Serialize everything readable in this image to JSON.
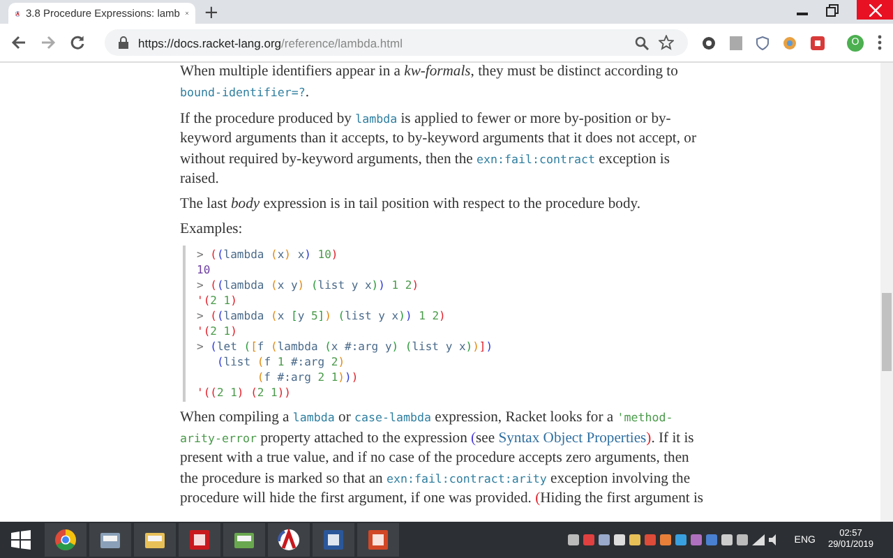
{
  "browser": {
    "tab": {
      "title": "3.8 Procedure Expressions: lamb",
      "selected": true
    },
    "new_tab": "+",
    "url": {
      "host": "https://docs.racket-lang.org",
      "path": "/reference/lambda.html"
    },
    "profile": "O"
  },
  "paragraphs": [
    [
      {
        "text": "When multiple identifiers appear in a ",
        "kind": "text"
      },
      {
        "text": "kw-formals",
        "kind": "ital"
      },
      {
        "text": ", they must be distinct according to ",
        "kind": "text"
      },
      {
        "text": "bound-identifier=?",
        "kind": "code"
      },
      {
        "text": ".",
        "kind": "text"
      }
    ],
    [
      {
        "text": "If the procedure produced by ",
        "kind": "text"
      },
      {
        "text": "lambda",
        "kind": "code"
      },
      {
        "text": " is applied to fewer or more by-position or by-keyword arguments than it accepts, to by-keyword arguments that it does not accept, or without required by-keyword arguments, then the ",
        "kind": "text"
      },
      {
        "text": "exn:fail:contract",
        "kind": "code"
      },
      {
        "text": " exception is raised.",
        "kind": "text"
      }
    ],
    [
      {
        "text": "The last ",
        "kind": "text"
      },
      {
        "text": "body",
        "kind": "ital"
      },
      {
        "text": " expression is in tail position with respect to the procedure body.",
        "kind": "text"
      }
    ]
  ],
  "examples_label": "Examples:",
  "code_lines": [
    [
      {
        "text": ">",
        "kind": "pr"
      },
      {
        "text": " (",
        "kind": "r"
      },
      {
        "text": "(",
        "kind": "b"
      },
      {
        "text": "lambda ",
        "kind": "id"
      },
      {
        "text": "(",
        "kind": "o"
      },
      {
        "text": "x",
        "kind": "id"
      },
      {
        "text": ")",
        "kind": "o"
      },
      {
        "text": " x",
        "kind": "id"
      },
      {
        "text": ")",
        "kind": "b"
      },
      {
        "text": " 10",
        "kind": "n"
      },
      {
        "text": ")",
        "kind": "r"
      }
    ],
    [
      {
        "text": "10",
        "kind": "res"
      }
    ],
    [
      {
        "text": ">",
        "kind": "pr"
      },
      {
        "text": " (",
        "kind": "r"
      },
      {
        "text": "(",
        "kind": "b"
      },
      {
        "text": "lambda ",
        "kind": "id"
      },
      {
        "text": "(",
        "kind": "o"
      },
      {
        "text": "x y",
        "kind": "id"
      },
      {
        "text": ")",
        "kind": "o"
      },
      {
        "text": " (",
        "kind": "g"
      },
      {
        "text": "list y x",
        "kind": "id"
      },
      {
        "text": ")",
        "kind": "g"
      },
      {
        "text": ")",
        "kind": "b"
      },
      {
        "text": " 1 2",
        "kind": "n"
      },
      {
        "text": ")",
        "kind": "r"
      }
    ],
    [
      {
        "text": "'(",
        "kind": "r"
      },
      {
        "text": "2 1",
        "kind": "n"
      },
      {
        "text": ")",
        "kind": "r"
      }
    ],
    [
      {
        "text": ">",
        "kind": "pr"
      },
      {
        "text": " (",
        "kind": "r"
      },
      {
        "text": "(",
        "kind": "b"
      },
      {
        "text": "lambda ",
        "kind": "id"
      },
      {
        "text": "(",
        "kind": "o"
      },
      {
        "text": "x ",
        "kind": "id"
      },
      {
        "text": "[",
        "kind": "g"
      },
      {
        "text": "y ",
        "kind": "id"
      },
      {
        "text": "5",
        "kind": "n"
      },
      {
        "text": "]",
        "kind": "g"
      },
      {
        "text": ")",
        "kind": "o"
      },
      {
        "text": " (",
        "kind": "g"
      },
      {
        "text": "list y x",
        "kind": "id"
      },
      {
        "text": ")",
        "kind": "g"
      },
      {
        "text": ")",
        "kind": "b"
      },
      {
        "text": " 1 2",
        "kind": "n"
      },
      {
        "text": ")",
        "kind": "r"
      }
    ],
    [
      {
        "text": "'(",
        "kind": "r"
      },
      {
        "text": "2 1",
        "kind": "n"
      },
      {
        "text": ")",
        "kind": "r"
      }
    ],
    [
      {
        "text": ">",
        "kind": "pr"
      },
      {
        "text": " (",
        "kind": "b"
      },
      {
        "text": "let ",
        "kind": "id"
      },
      {
        "text": "(",
        "kind": "g"
      },
      {
        "text": "[",
        "kind": "o"
      },
      {
        "text": "f ",
        "kind": "id"
      },
      {
        "text": "(",
        "kind": "o"
      },
      {
        "text": "lambda ",
        "kind": "id"
      },
      {
        "text": "(",
        "kind": "g"
      },
      {
        "text": "x #:arg y",
        "kind": "id"
      },
      {
        "text": ")",
        "kind": "g"
      },
      {
        "text": " (",
        "kind": "g"
      },
      {
        "text": "list y x",
        "kind": "id"
      },
      {
        "text": ")",
        "kind": "g"
      },
      {
        "text": ")",
        "kind": "o"
      },
      {
        "text": "]",
        "kind": "r"
      },
      {
        "text": ")",
        "kind": "b"
      }
    ],
    [
      {
        "text": "   (",
        "kind": "b"
      },
      {
        "text": "list ",
        "kind": "id"
      },
      {
        "text": "(",
        "kind": "o"
      },
      {
        "text": "f ",
        "kind": "id"
      },
      {
        "text": "1",
        "kind": "n"
      },
      {
        "text": " #:arg ",
        "kind": "id"
      },
      {
        "text": "2",
        "kind": "n"
      },
      {
        "text": ")",
        "kind": "o"
      }
    ],
    [
      {
        "text": "         (",
        "kind": "o"
      },
      {
        "text": "f #:arg ",
        "kind": "id"
      },
      {
        "text": "2 1",
        "kind": "n"
      },
      {
        "text": ")",
        "kind": "o"
      },
      {
        "text": ")",
        "kind": "b"
      },
      {
        "text": ")",
        "kind": "r"
      }
    ],
    [
      {
        "text": "'(",
        "kind": "r"
      },
      {
        "text": "(",
        "kind": "r"
      },
      {
        "text": "2 1",
        "kind": "n"
      },
      {
        "text": ")",
        "kind": "r"
      },
      {
        "text": " (",
        "kind": "r"
      },
      {
        "text": "2 1",
        "kind": "n"
      },
      {
        "text": ")",
        "kind": "r"
      },
      {
        "text": ")",
        "kind": "r"
      }
    ]
  ],
  "final_paragraph": [
    {
      "text": "When compiling a ",
      "kind": "text"
    },
    {
      "text": "lambda",
      "kind": "code"
    },
    {
      "text": " or ",
      "kind": "text"
    },
    {
      "text": "case-lambda",
      "kind": "code"
    },
    {
      "text": " expression, Racket looks for a ",
      "kind": "text"
    },
    {
      "text": "'method-arity-error",
      "kind": "sym"
    },
    {
      "text": " property attached to the expression ",
      "kind": "text"
    },
    {
      "text": "(",
      "kind": "pb"
    },
    {
      "text": "see ",
      "kind": "text"
    },
    {
      "text": "Syntax Object Properties",
      "kind": "link"
    },
    {
      "text": ")",
      "kind": "pr"
    },
    {
      "text": ". If it is present with a true value, and if no case of the procedure accepts zero arguments, then the procedure is marked so that an ",
      "kind": "text"
    },
    {
      "text": "exn:fail:contract:arity",
      "kind": "code"
    },
    {
      "text": " exception involving the procedure will hide the first argument, if one was provided. ",
      "kind": "text"
    },
    {
      "text": "(",
      "kind": "pr"
    },
    {
      "text": "Hiding the first argument is",
      "kind": "text"
    }
  ],
  "taskbar": {
    "apps": [
      {
        "kind": "chrome"
      },
      {
        "kind": "scanner"
      },
      {
        "kind": "folder"
      },
      {
        "kind": "acrobat"
      },
      {
        "kind": "notepad"
      },
      {
        "kind": "racket"
      },
      {
        "kind": "word"
      },
      {
        "kind": "powerpoint"
      }
    ],
    "language": "ENG",
    "time": "02:57",
    "date": "29/01/2019"
  }
}
